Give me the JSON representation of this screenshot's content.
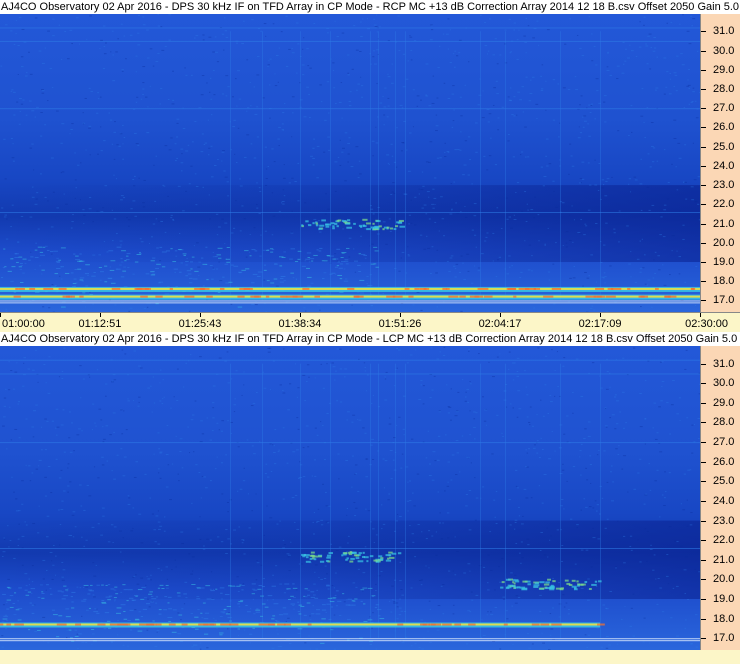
{
  "panels": [
    {
      "title": "AJ4CO Observatory 02 Apr 2016 - DPS 30 kHz IF on TFD Array in CP Mode - RCP  MC +13 dB  Correction Array 2014 12 18 B.csv  Offset 2050  Gain 5.0",
      "ylabels": [
        "31.0",
        "30.0",
        "29.0",
        "28.0",
        "27.0",
        "26.0",
        "25.0",
        "24.0",
        "23.0",
        "22.0",
        "21.0",
        "20.0",
        "19.0",
        "18.0",
        "17.0"
      ],
      "xlabels": [
        "01:00:00",
        "01:12:51",
        "01:25:43",
        "01:38:34",
        "01:51:26",
        "02:04:17",
        "02:17:09",
        "02:30:00"
      ]
    },
    {
      "title": "AJ4CO Observatory 02 Apr 2016 - DPS 30 kHz IF on TFD Array in CP Mode - LCP  MC +13 dB  Correction Array 2014 12 18 B.csv  Offset 2050  Gain 5.0",
      "ylabels": [
        "31.0",
        "30.0",
        "29.0",
        "28.0",
        "27.0",
        "26.0",
        "25.0",
        "24.0",
        "23.0",
        "22.0",
        "21.0",
        "20.0",
        "19.0",
        "18.0",
        "17.0"
      ],
      "xlabels": []
    }
  ],
  "chart_data": [
    {
      "type": "heatmap",
      "title": "AJ4CO Observatory 02 Apr 2016 - DPS 30 kHz IF on TFD Array in CP Mode - RCP  MC +13 dB  Correction Array 2014 12 18 B.csv  Offset 2050  Gain 5.0",
      "x_ticks": [
        "01:00:00",
        "01:12:51",
        "01:25:43",
        "01:38:34",
        "01:51:26",
        "02:04:17",
        "02:17:09",
        "02:30:00"
      ],
      "y_ticks": [
        31.0,
        30.0,
        29.0,
        28.0,
        27.0,
        26.0,
        25.0,
        24.0,
        23.0,
        22.0,
        21.0,
        20.0,
        19.0,
        18.0,
        17.0
      ],
      "ylim": [
        16.4,
        31.9
      ],
      "colormap": [
        "#0a2a9c",
        "#1a4bc8",
        "#2f7de8",
        "#39c6e6",
        "#7ee08a",
        "#f0e040",
        "#f07030"
      ],
      "features": [
        {
          "freq": 17.6,
          "t_start": "01:00:00",
          "t_end": "02:30:00",
          "level": "high"
        },
        {
          "freq": 17.2,
          "t_start": "01:00:00",
          "t_end": "02:30:00",
          "level": "high"
        },
        {
          "freq": 21.0,
          "t_start": "01:38:34",
          "t_end": "01:51:26",
          "level": "medium"
        }
      ]
    },
    {
      "type": "heatmap",
      "title": "AJ4CO Observatory 02 Apr 2016 - DPS 30 kHz IF on TFD Array in CP Mode - LCP  MC +13 dB  Correction Array 2014 12 18 B.csv  Offset 2050  Gain 5.0",
      "y_ticks": [
        31.0,
        30.0,
        29.0,
        28.0,
        27.0,
        26.0,
        25.0,
        24.0,
        23.0,
        22.0,
        21.0,
        20.0,
        19.0,
        18.0,
        17.0
      ],
      "ylim": [
        16.4,
        31.9
      ],
      "colormap": [
        "#0a2a9c",
        "#1a4bc8",
        "#2f7de8",
        "#39c6e6",
        "#7ee08a",
        "#f0e040",
        "#f07030"
      ],
      "features": [
        {
          "freq": 17.7,
          "t_start": "01:00:00",
          "t_end": "02:17:09",
          "level": "high"
        },
        {
          "freq": 21.2,
          "t_start": "01:38:34",
          "t_end": "01:51:26",
          "level": "medium"
        },
        {
          "freq": 19.8,
          "t_start": "02:04:17",
          "t_end": "02:17:09",
          "level": "medium"
        }
      ]
    }
  ]
}
